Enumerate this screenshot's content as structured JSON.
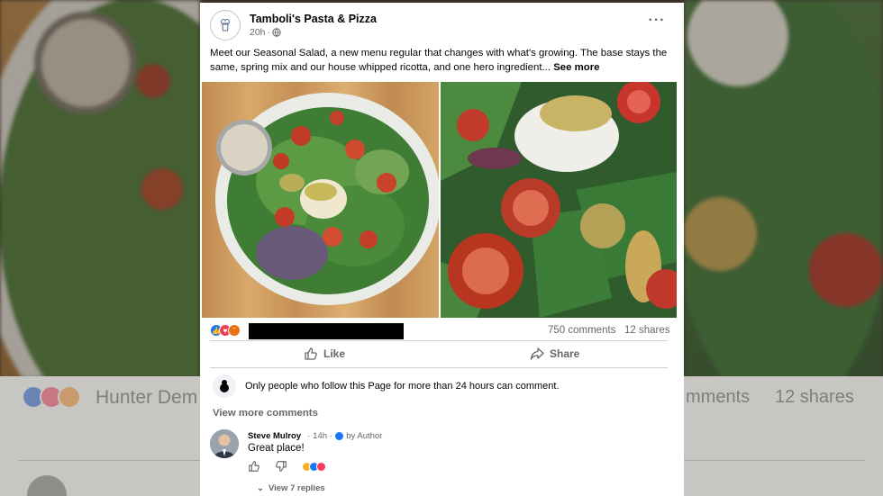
{
  "post": {
    "page_name": "Tamboli's Pasta & Pizza",
    "time": "20h",
    "caption": "Meet our Seasonal Salad, a new menu regular that changes with what's growing. The base stays the same, spring mix and our house whipped ricotta, and one hero ingredient...",
    "see_more": "See more",
    "comments_count": "750 comments",
    "shares_count": "12 shares",
    "like_label": "Like",
    "share_label": "Share",
    "restriction_notice": "Only people who follow this Page for more than 24 hours can comment.",
    "view_more_comments": "View more comments",
    "reactions": [
      "like",
      "love",
      "angry"
    ]
  },
  "comment": {
    "author": "Steve Mulroy",
    "time": "14h",
    "liked_by": "by Author",
    "text": "Great place!",
    "view_replies": "View 7 replies",
    "reactions": [
      "haha",
      "like",
      "love"
    ]
  },
  "backdrop": {
    "name": "Hunter Dem",
    "comments": "mments",
    "shares": "12 shares"
  },
  "colors": {
    "accent": "#1877f2",
    "love": "#f33e58",
    "angry": "#e9710f",
    "muted_text": "#65676b"
  }
}
